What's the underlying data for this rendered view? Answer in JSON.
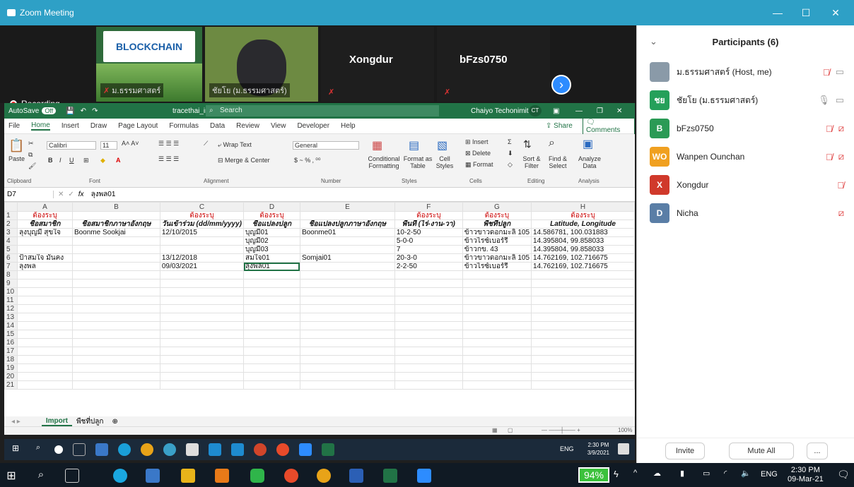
{
  "zoom": {
    "window_title": "Zoom Meeting",
    "recording_label": "Recording...",
    "tiles": [
      {
        "name": "ม.ธรรมศาสตร์"
      },
      {
        "name": "ชัยโย (ม.ธรรมศาสตร์)"
      },
      {
        "name": "Xongdur"
      },
      {
        "name": "bFzs0750"
      }
    ],
    "logo_text": "BLOCKCHAIN"
  },
  "excel": {
    "autosave": "AutoSave",
    "autosave_state": "Off",
    "file_title": "tracethai_import.xlsx - Saved",
    "search_placeholder": "Search",
    "user_name": "Chaiyo Techonimit",
    "user_initials": "CT",
    "menu": [
      "File",
      "Home",
      "Insert",
      "Draw",
      "Page Layout",
      "Formulas",
      "Data",
      "Review",
      "View",
      "Developer",
      "Help"
    ],
    "share_label": "Share",
    "comments_label": "Comments",
    "ribbon": {
      "paste": "Paste",
      "font_name": "Calibri",
      "font_size": "11",
      "wrap_text": "Wrap Text",
      "merge_center": "Merge & Center",
      "number_format": "General",
      "cond_format": "Conditional Formatting",
      "format_table": "Format as Table",
      "cell_styles": "Cell Styles",
      "insert": "Insert",
      "delete": "Delete",
      "format": "Format",
      "sort_filter": "Sort & Filter",
      "find_select": "Find & Select",
      "analyze": "Analyze Data",
      "groups": [
        "Clipboard",
        "Font",
        "Alignment",
        "Number",
        "Styles",
        "Cells",
        "Editing",
        "Analysis"
      ]
    },
    "name_box": "D7",
    "formula": "ลุงพล01",
    "columns": [
      "A",
      "B",
      "C",
      "D",
      "E",
      "F",
      "G",
      "H"
    ],
    "rows": [
      [
        "ต้องระบุ",
        "",
        "ต้องระบุ",
        "ต้องระบุ",
        "",
        "ต้องระบุ",
        "ต้องระบุ",
        "ต้องระบุ"
      ],
      [
        "ชื่อสมาชิก",
        "ชื่อสมาชิกภาษาอังกฤษ",
        "วันเข้าร่วม (dd/mm/yyyy)",
        "ชื่อแปลงปลูก",
        "ชื่อแปลงปลูกภาษาอังกฤษ",
        "พื้นที่ (ไร่-งาน-วา)",
        "พืชที่ปลูก",
        "Latitude, Longitude"
      ],
      [
        "ลุงบุญมี สุขใจ",
        "Boonme Sookjai",
        "12/10/2015",
        "บุญมี01",
        "Boonme01",
        "10-2-50",
        "ข้าวขาวดอกมะลิ 105",
        "14.586781, 100.031883"
      ],
      [
        "",
        "",
        "",
        "บุญมี02",
        "",
        "5-0-0",
        "ข้าวไรซ์เบอร์รี่",
        "14.395804, 99.858033"
      ],
      [
        "",
        "",
        "",
        "บุญมี03",
        "",
        "7",
        "ข้าวกข. 43",
        "14.395804, 99.858033"
      ],
      [
        "ป้าสมใจ มั่นคง",
        "",
        "13/12/2018",
        "สมใจ01",
        "Somjai01",
        "20-3-0",
        "ข้าวขาวดอกมะลิ 105",
        "14.762169, 102.716675"
      ],
      [
        "ลุงพล",
        "",
        "09/03/2021",
        "ลุงพล01",
        "",
        "2-2-50",
        "ข้าวไรซ์เบอร์รี่",
        "14.762169, 102.716675"
      ],
      [
        "",
        "",
        "",
        "",
        "",
        "",
        "",
        ""
      ],
      [
        "",
        "",
        "",
        "",
        "",
        "",
        "",
        ""
      ],
      [
        "",
        "",
        "",
        "",
        "",
        "",
        "",
        ""
      ],
      [
        "",
        "",
        "",
        "",
        "",
        "",
        "",
        ""
      ],
      [
        "",
        "",
        "",
        "",
        "",
        "",
        "",
        ""
      ],
      [
        "",
        "",
        "",
        "",
        "",
        "",
        "",
        ""
      ],
      [
        "",
        "",
        "",
        "",
        "",
        "",
        "",
        ""
      ],
      [
        "",
        "",
        "",
        "",
        "",
        "",
        "",
        ""
      ],
      [
        "",
        "",
        "",
        "",
        "",
        "",
        "",
        ""
      ],
      [
        "",
        "",
        "",
        "",
        "",
        "",
        "",
        ""
      ],
      [
        "",
        "",
        "",
        "",
        "",
        "",
        "",
        ""
      ],
      [
        "",
        "",
        "",
        "",
        "",
        "",
        "",
        ""
      ],
      [
        "",
        "",
        "",
        "",
        "",
        "",
        "",
        ""
      ],
      [
        "",
        "",
        "",
        "",
        "",
        "",
        "",
        ""
      ]
    ],
    "sheet_tabs": [
      "Import",
      "พืชที่ปลูก"
    ],
    "zoom_level": "100%",
    "inner_clock_time": "2:30 PM",
    "inner_clock_date": "3/9/2021",
    "inner_lang": "ENG"
  },
  "participants": {
    "title": "Participants (6)",
    "list": [
      {
        "name": "ม.ธรรมศาสตร์ (Host, me)",
        "initials": "",
        "color": "#8a9aa8",
        "mic": "off",
        "cam": "on"
      },
      {
        "name": "ชัยโย (ม.ธรรมศาสตร์)",
        "initials": "ชย",
        "color": "#25a05a",
        "mic": "on",
        "cam": "on"
      },
      {
        "name": "bFzs0750",
        "initials": "B",
        "color": "#2a9a55",
        "mic": "off",
        "cam": "off"
      },
      {
        "name": "Wanpen Ounchan",
        "initials": "WO",
        "color": "#f0a020",
        "mic": "off",
        "cam": "off"
      },
      {
        "name": "Xongdur",
        "initials": "X",
        "color": "#d0392b",
        "mic": "off",
        "cam": "none"
      },
      {
        "name": "Nicha",
        "initials": "D",
        "color": "#5a7ea6",
        "mic": "none",
        "cam": "off"
      }
    ],
    "invite_label": "Invite",
    "mute_all_label": "Mute All",
    "more_label": "..."
  },
  "taskbar": {
    "battery": "94%",
    "lang": "ENG",
    "time": "2:30 PM",
    "date": "09-Mar-21"
  }
}
